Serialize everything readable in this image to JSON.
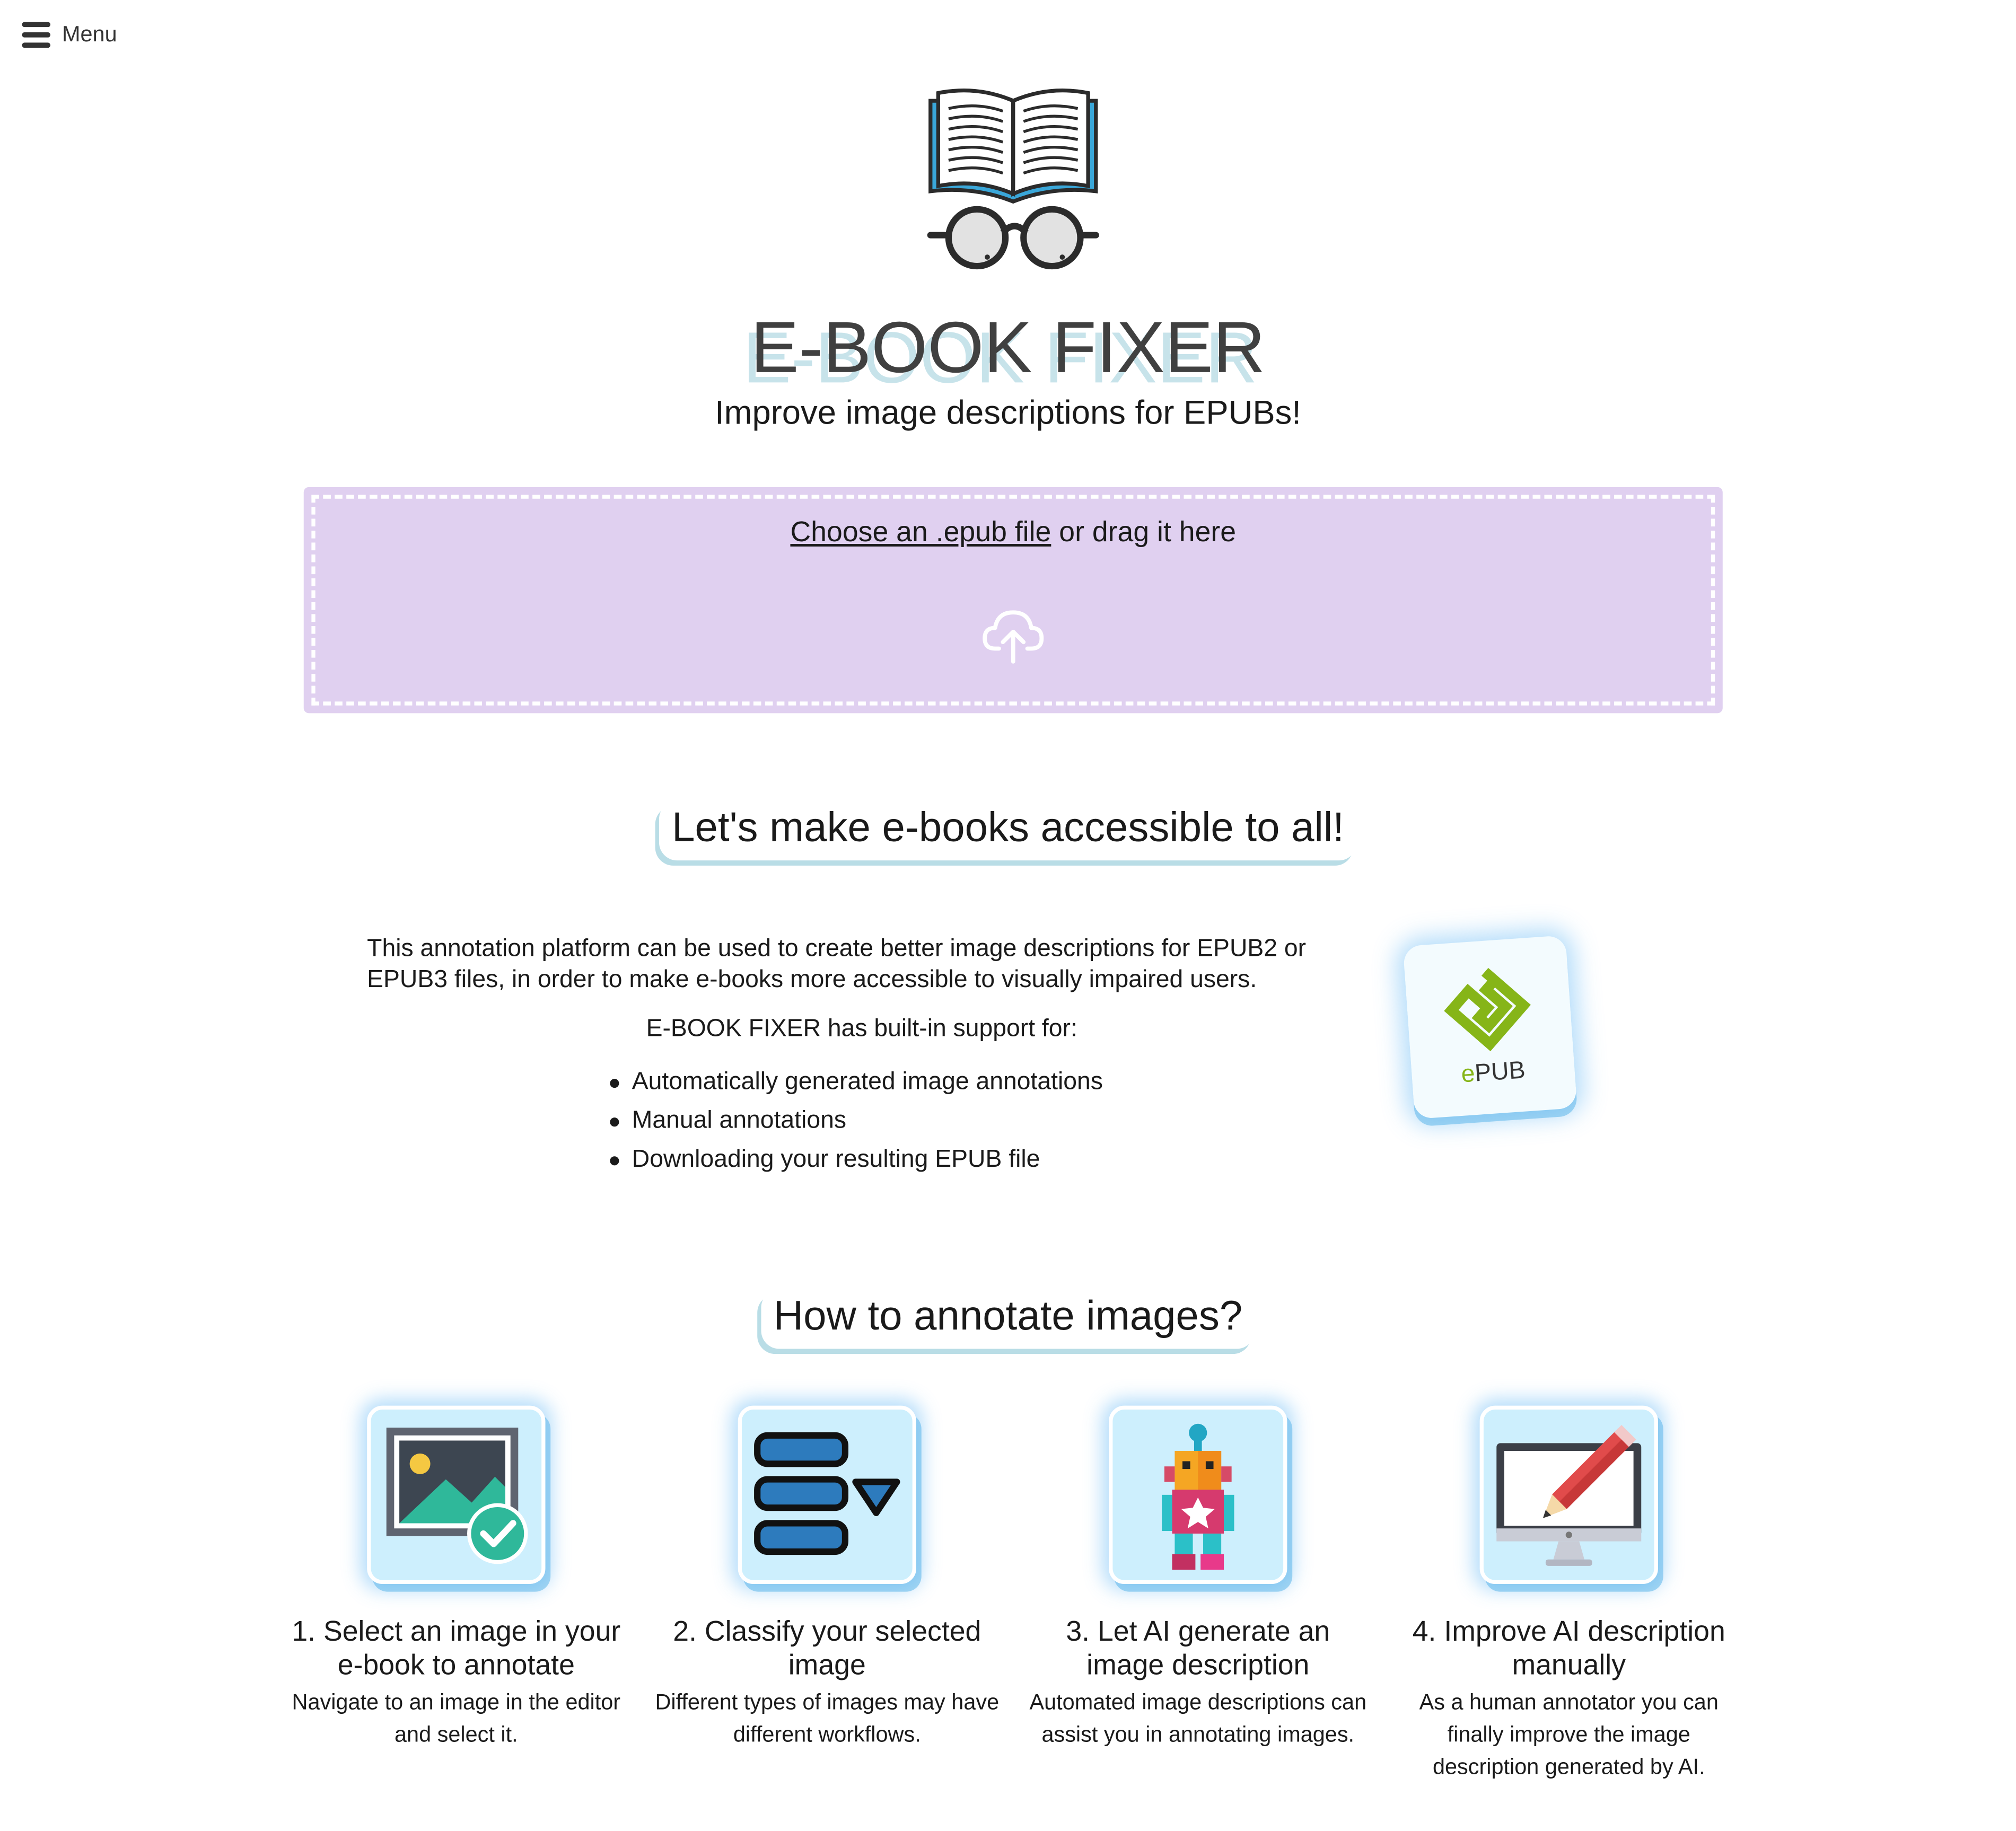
{
  "menu": {
    "label": "Menu",
    "icon": "hamburger-icon"
  },
  "hero": {
    "logo": "book-with-glasses-logo",
    "title": "E-BOOK FIXER",
    "subtitle": "Improve image descriptions for EPUBs!"
  },
  "upload": {
    "link_label": "Choose an .epub file",
    "text_suffix": " or drag it here",
    "icon": "cloud-upload-icon",
    "background_color": "#e0d0f0"
  },
  "about": {
    "heading": "Let's make e-books accessible to all!",
    "paragraph": "This annotation platform can be used to create better image descriptions for EPUB2 or EPUB3 files, in order to make e-books more accessible to visually impaired users.",
    "support_intro": "E-BOOK FIXER has built-in support for:",
    "features": [
      "Automatically generated image annotations",
      "Manual annotations",
      "Downloading your resulting EPUB file"
    ],
    "badge": {
      "icon": "epub-logo-icon",
      "prefix": "e",
      "suffix": "PUB",
      "accent": "#86b518"
    }
  },
  "howto": {
    "heading": "How to annotate images?",
    "steps": [
      {
        "icon": "image-check-icon",
        "title": "1. Select an image in your e-book to annotate",
        "description": "Navigate to an image in the editor and select it."
      },
      {
        "icon": "classify-list-icon",
        "title": "2. Classify your selected image",
        "description": "Different types of images may have different workflows."
      },
      {
        "icon": "robot-icon",
        "title": "3. Let AI generate an image description",
        "description": "Automated image descriptions can assist you in annotating images."
      },
      {
        "icon": "monitor-pencil-icon",
        "title": "4. Improve AI description manually",
        "description": "As a human annotator you can finally improve the image description generated by AI."
      }
    ]
  },
  "colors": {
    "accent_blue": "#b9dde6",
    "icon_tile": "#cdeffd",
    "title_text": "#404040"
  }
}
